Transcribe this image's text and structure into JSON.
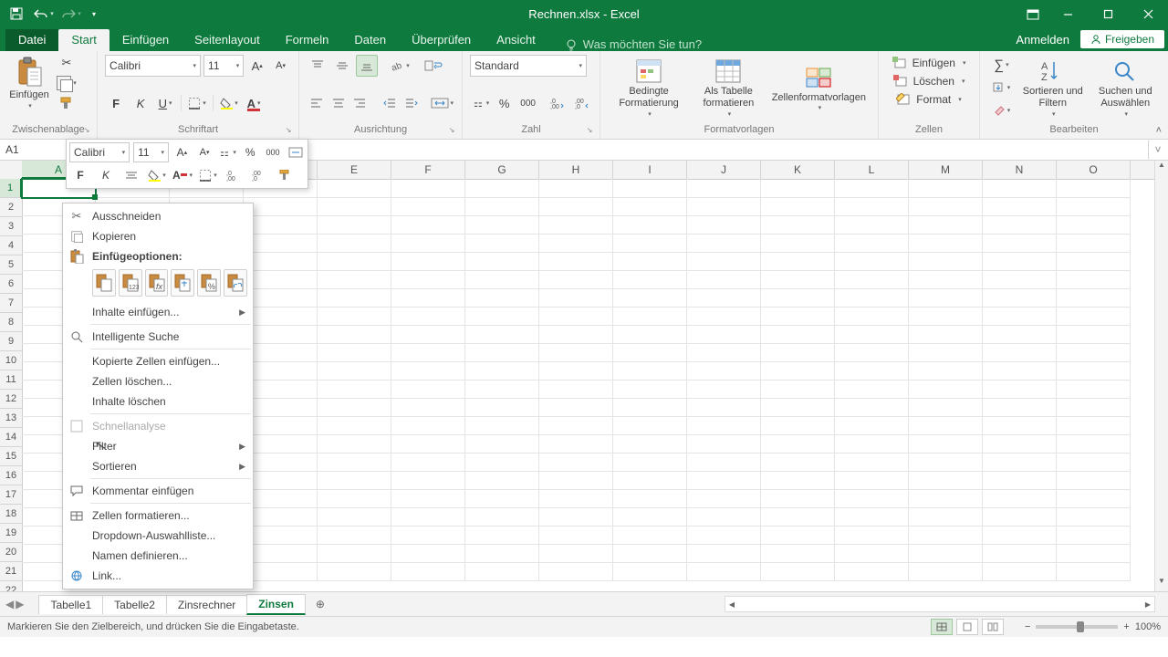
{
  "title": "Rechnen.xlsx - Excel",
  "tabs": {
    "file": "Datei",
    "items": [
      "Start",
      "Einfügen",
      "Seitenlayout",
      "Formeln",
      "Daten",
      "Überprüfen",
      "Ansicht"
    ],
    "active": "Start",
    "tellme": "Was möchten Sie tun?",
    "anmelden": "Anmelden",
    "share": "Freigeben"
  },
  "ribbon": {
    "clipboard": {
      "paste": "Einfügen",
      "label": "Zwischenablage"
    },
    "font": {
      "name": "Calibri",
      "size": "11",
      "label": "Schriftart"
    },
    "align": {
      "label": "Ausrichtung"
    },
    "number": {
      "format": "Standard",
      "label": "Zahl"
    },
    "styles": {
      "cond": "Bedingte Formatierung",
      "table": "Als Tabelle formatieren",
      "cell": "Zellenformatvorlagen",
      "label": "Formatvorlagen"
    },
    "cells": {
      "insert": "Einfügen",
      "delete": "Löschen",
      "format": "Format",
      "label": "Zellen"
    },
    "editing": {
      "sort": "Sortieren und Filtern",
      "find": "Suchen und Auswählen",
      "label": "Bearbeiten"
    }
  },
  "namebox": "A1",
  "cols": [
    "A",
    "B",
    "C",
    "D",
    "E",
    "F",
    "G",
    "H",
    "I",
    "J",
    "K",
    "L",
    "M",
    "N",
    "O"
  ],
  "rows": 22,
  "minitb": {
    "font": "Calibri",
    "size": "11"
  },
  "ctx": {
    "cut": "Ausschneiden",
    "copy": "Kopieren",
    "pastehdr": "Einfügeoptionen:",
    "pastespecial": "Inhalte einfügen...",
    "smartlookup": "Intelligente Suche",
    "insertcopied": "Kopierte Zellen einfügen...",
    "deletecells": "Zellen löschen...",
    "clearcontents": "Inhalte löschen",
    "quick": "Schnellanalyse",
    "filter": "Filter",
    "sort": "Sortieren",
    "comment": "Kommentar einfügen",
    "formatcells": "Zellen formatieren...",
    "dropdown": "Dropdown-Auswahlliste...",
    "definename": "Namen definieren...",
    "link": "Link..."
  },
  "sheets": {
    "items": [
      "Tabelle1",
      "Tabelle2",
      "Zinsrechner",
      "Zinsen"
    ],
    "active": "Zinsen"
  },
  "status": "Markieren Sie den Zielbereich, und drücken Sie die Eingabetaste.",
  "zoom": "100%"
}
